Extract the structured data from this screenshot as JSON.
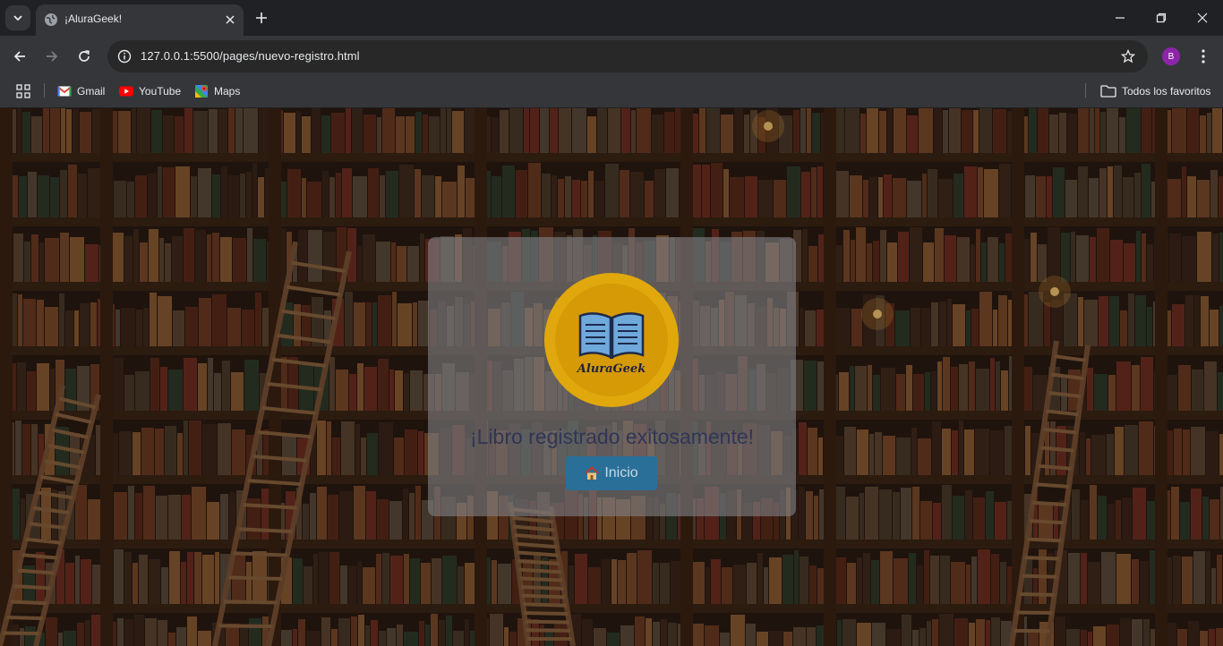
{
  "browser": {
    "tab": {
      "title": "¡AluraGeek!"
    },
    "address_bar": {
      "url": "127.0.0.1:5500/pages/nuevo-registro.html"
    },
    "profile_initial": "B",
    "bookmarks": [
      {
        "label": "Gmail",
        "icon": "gmail-icon"
      },
      {
        "label": "YouTube",
        "icon": "youtube-icon"
      },
      {
        "label": "Maps",
        "icon": "maps-icon"
      }
    ],
    "all_bookmarks_label": "Todos los favoritos"
  },
  "page": {
    "logo_text": "AluraGeek",
    "message": "¡Libro registrado exitosamente!",
    "home_button": {
      "label": "Inicio",
      "icon": "house-icon"
    },
    "colors": {
      "card": "#808084",
      "logo": "#e0a80c",
      "button": "#2a6f98",
      "message": "#2f3656"
    }
  }
}
